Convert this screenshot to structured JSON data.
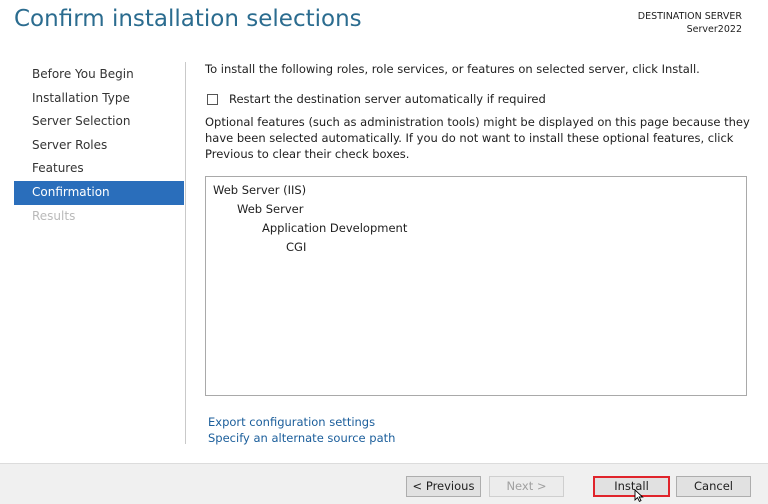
{
  "header": {
    "title": "Confirm installation selections",
    "destination_label": "DESTINATION SERVER",
    "destination_server": "Server2022"
  },
  "nav": {
    "items": [
      {
        "label": "Before You Begin",
        "state": "normal"
      },
      {
        "label": "Installation Type",
        "state": "normal"
      },
      {
        "label": "Server Selection",
        "state": "normal"
      },
      {
        "label": "Server Roles",
        "state": "normal"
      },
      {
        "label": "Features",
        "state": "normal"
      },
      {
        "label": "Confirmation",
        "state": "active"
      },
      {
        "label": "Results",
        "state": "disabled"
      }
    ]
  },
  "content": {
    "intro": "To install the following roles, role services, or features on selected server, click Install.",
    "restart_label": "Restart the destination server automatically if required",
    "restart_checked": false,
    "optional_text": "Optional features (such as administration tools) might be displayed on this page because they have been selected automatically. If you do not want to install these optional features, click Previous to clear their check boxes.",
    "selections": [
      {
        "label": "Web Server (IIS)",
        "level": 0
      },
      {
        "label": "Web Server",
        "level": 1
      },
      {
        "label": "Application Development",
        "level": 2
      },
      {
        "label": "CGI",
        "level": 3
      }
    ],
    "links": {
      "export": "Export configuration settings",
      "alternate_source": "Specify an alternate source path"
    }
  },
  "footer": {
    "previous": "< Previous",
    "next": "Next >",
    "install": "Install",
    "cancel": "Cancel"
  },
  "colors": {
    "title": "#2b6c8f",
    "nav_active_bg": "#2a6ebb",
    "link": "#1b5e9b",
    "install_highlight": "#e0242b"
  }
}
